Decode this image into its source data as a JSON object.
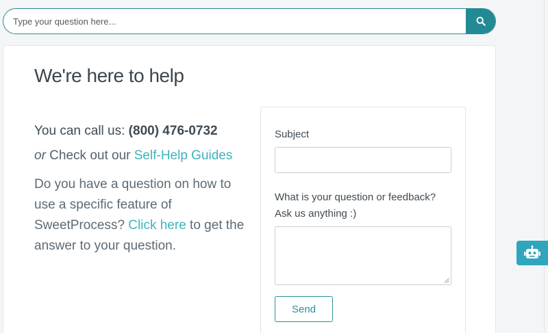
{
  "search": {
    "placeholder": "Type your question here...",
    "button_icon": "search-icon"
  },
  "help": {
    "title": "We're here to help",
    "call_prefix": "You can call us: ",
    "phone": "(800) 476-0732",
    "guides_or": "or",
    "guides_text": " Check out our ",
    "guides_link": "Self-Help Guides",
    "question_text_1": "Do you have a question on how to use a specific feature of SweetProcess? ",
    "question_link": "Click here",
    "question_text_2": " to get the answer to your question."
  },
  "form": {
    "subject_label": "Subject",
    "subject_value": "",
    "question_label": "What is your question or feedback? Ask us anything :)",
    "question_value": "",
    "send_label": "Send"
  },
  "bot": {
    "icon": "robot-icon"
  },
  "colors": {
    "accent": "#228a94",
    "link": "#3eb3bd",
    "bot": "#2fa6bd"
  }
}
